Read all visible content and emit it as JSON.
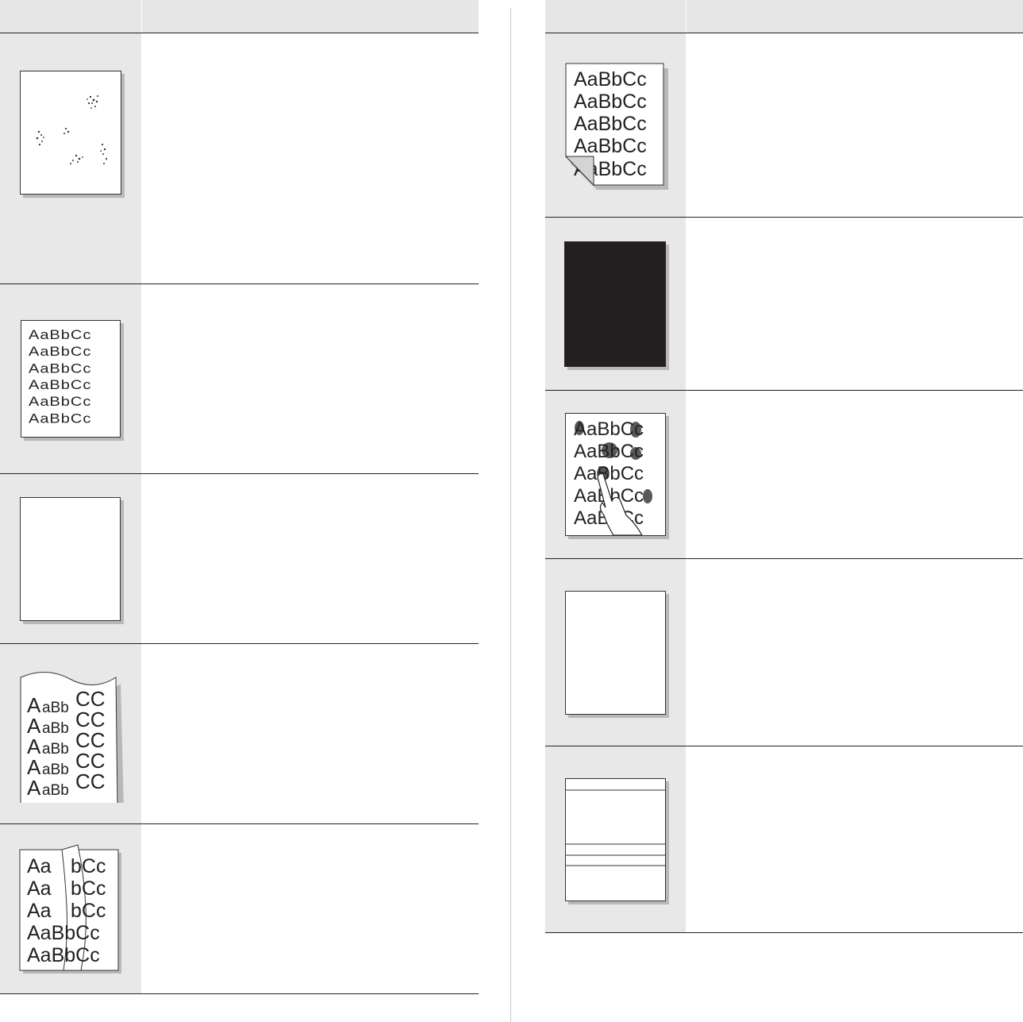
{
  "left_table": {
    "header": {
      "col1": "",
      "col2": ""
    },
    "rows": [
      {
        "illustration": "scattered-toner-spots-page",
        "description": ""
      },
      {
        "illustration": "faded-text-page",
        "description": ""
      },
      {
        "illustration": "blank-page",
        "description": ""
      },
      {
        "illustration": "curled-paper-page",
        "description": ""
      },
      {
        "illustration": "creased-paper-page",
        "description": ""
      }
    ]
  },
  "right_table": {
    "header": {
      "col1": "",
      "col2": ""
    },
    "rows": [
      {
        "illustration": "folded-corner-page",
        "description": ""
      },
      {
        "illustration": "solid-black-page",
        "description": ""
      },
      {
        "illustration": "smudged-toner-page",
        "description": ""
      },
      {
        "illustration": "blank-page",
        "description": ""
      },
      {
        "illustration": "horizontal-lines-page",
        "description": ""
      }
    ]
  },
  "samples": {
    "normal_text": "AaBbCc",
    "stretched_text": "AaBbCc",
    "curl_text_a": "A",
    "curl_text_ab": "aBb",
    "curl_text_cc": "CC",
    "torn_left": "Aa",
    "torn_right": "bCc",
    "smudge_1": "AaBbCc",
    "smudge_2": "AaBbCc",
    "smudge_3": "AaBbCc",
    "smudge_4": "AaBbCc",
    "smudge_5": "AaBbCc"
  }
}
